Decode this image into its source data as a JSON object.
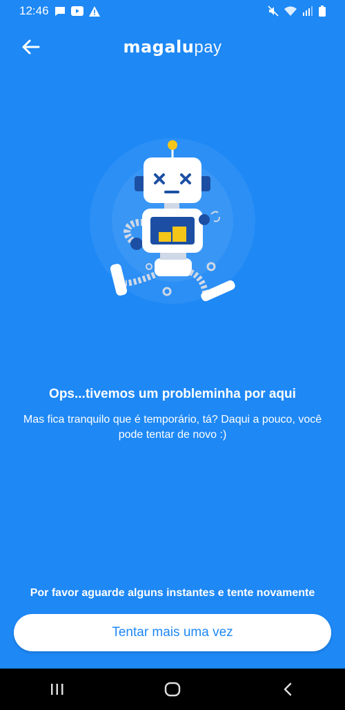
{
  "status_bar": {
    "time": "12:46",
    "left_icons": [
      "message-icon",
      "youtube-icon",
      "warning-icon"
    ],
    "right_icons": [
      "mute-icon",
      "wifi-icon",
      "signal-icon",
      "battery-icon"
    ]
  },
  "app_bar": {
    "logo_strong": "magalu",
    "logo_light": "pay",
    "back_icon": "arrow-left-icon"
  },
  "illustration": {
    "icon": "broken-robot-illustration"
  },
  "message": {
    "title": "Ops...tivemos um probleminha por aqui",
    "body": "Mas fica tranquilo que é temporário, tá? Daqui a pouco, você pode tentar de novo :)"
  },
  "footer": {
    "wait_text": "Por favor aguarde alguns instantes e tente novamente",
    "retry_label": "Tentar mais uma vez"
  },
  "nav_bar": {
    "icons": [
      "recent-apps-icon",
      "home-icon",
      "back-icon"
    ]
  },
  "colors": {
    "background": "#1e88f5",
    "button_bg": "#ffffff",
    "button_text": "#1e88f5",
    "robot_accent": "#f5c518"
  }
}
